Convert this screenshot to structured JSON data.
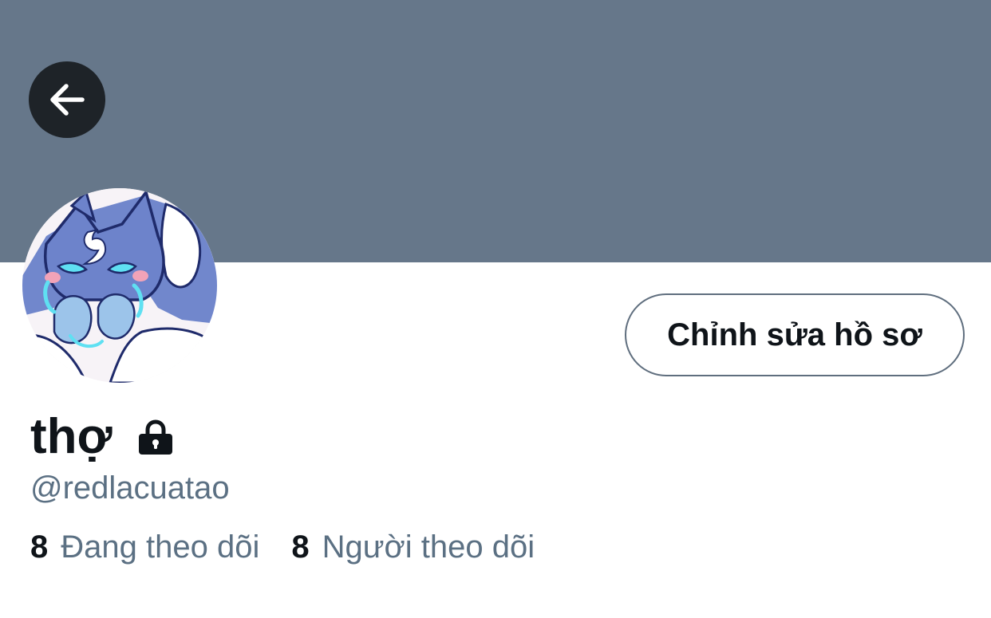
{
  "banner": {
    "color": "#66778a"
  },
  "header": {
    "back_icon": "arrow-left-icon"
  },
  "profile": {
    "display_name": "thợ",
    "lock_icon": "lock-icon",
    "handle": "@redlacuatao",
    "edit_button_label": "Chỉnh sửa hồ sơ"
  },
  "stats": {
    "following_count": "8",
    "following_label": "Đang theo dõi",
    "followers_count": "8",
    "followers_label": "Người theo dõi"
  },
  "colors": {
    "text_primary": "#0f1419",
    "text_secondary": "#5b7083",
    "button_border": "#5f6e7e",
    "back_button_bg": "#1e2328"
  }
}
